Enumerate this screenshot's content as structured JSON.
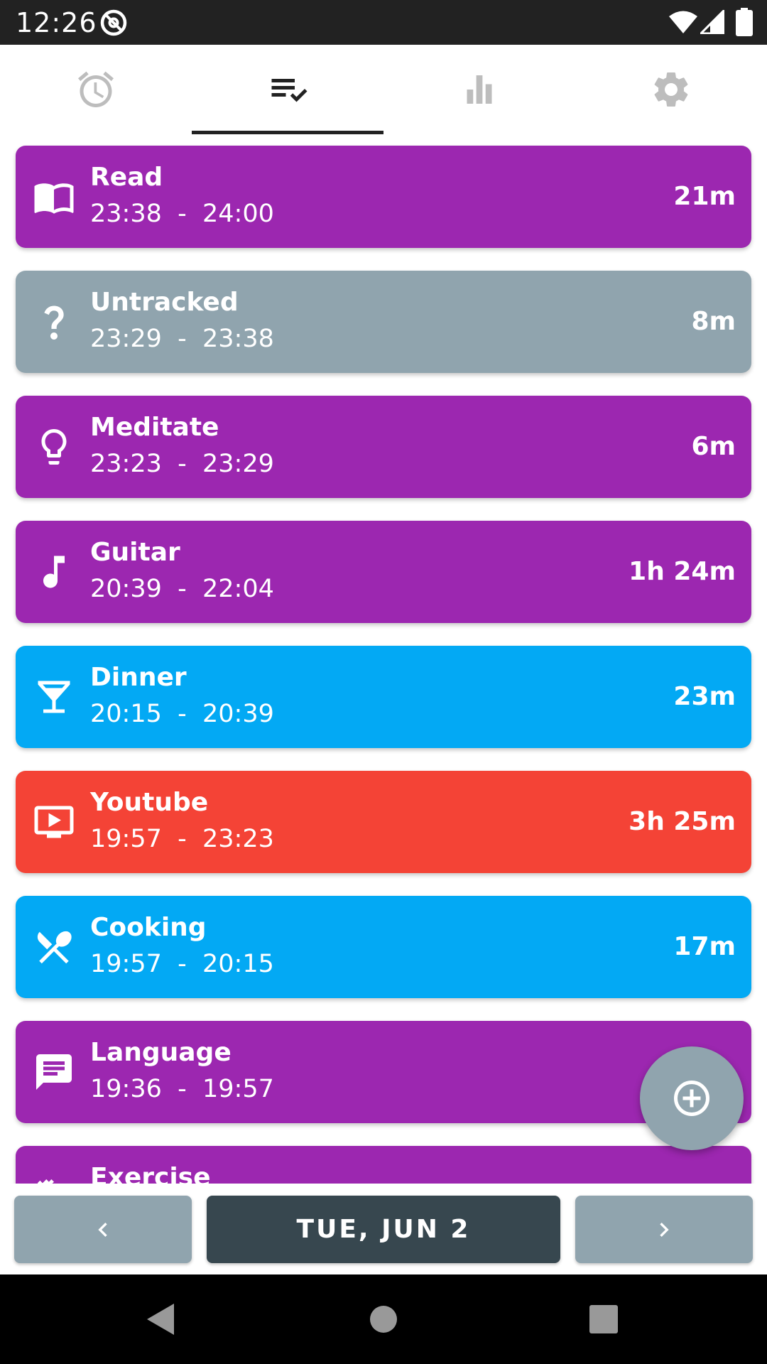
{
  "status_bar": {
    "time": "12:26"
  },
  "tabs": [
    {
      "name": "timer",
      "icon": "alarm-icon",
      "selected": false
    },
    {
      "name": "log",
      "icon": "checklist-icon",
      "selected": true
    },
    {
      "name": "stats",
      "icon": "bar-chart-icon",
      "selected": false
    },
    {
      "name": "settings",
      "icon": "gear-icon",
      "selected": false
    }
  ],
  "entries": [
    {
      "title": "Read",
      "time": "23:38  -  24:00",
      "duration": "21m",
      "icon": "book-icon",
      "color": "#9c27b0"
    },
    {
      "title": "Untracked",
      "time": "23:29  -  23:38",
      "duration": "8m",
      "icon": "question-icon",
      "color": "#90a4ae"
    },
    {
      "title": "Meditate",
      "time": "23:23  -  23:29",
      "duration": "6m",
      "icon": "lightbulb-icon",
      "color": "#9c27b0"
    },
    {
      "title": "Guitar",
      "time": "20:39  -  22:04",
      "duration": "1h 24m",
      "icon": "music-note-icon",
      "color": "#9c27b0"
    },
    {
      "title": "Dinner",
      "time": "20:15  -  20:39",
      "duration": "23m",
      "icon": "cocktail-icon",
      "color": "#03a9f4"
    },
    {
      "title": "Youtube",
      "time": "19:57  -  23:23",
      "duration": "3h 25m",
      "icon": "tv-play-icon",
      "color": "#f44336"
    },
    {
      "title": "Cooking",
      "time": "19:57  -  20:15",
      "duration": "17m",
      "icon": "utensils-icon",
      "color": "#03a9f4"
    },
    {
      "title": "Language",
      "time": "19:36  -  19:57",
      "duration": "",
      "icon": "message-icon",
      "color": "#9c27b0"
    },
    {
      "title": "Exercise",
      "time": "",
      "duration": "",
      "icon": "exercise-icon",
      "color": "#9c27b0"
    }
  ],
  "date_nav": {
    "date_label": "TUE, JUN 2"
  },
  "fab": {
    "icon": "add-circle-icon"
  }
}
